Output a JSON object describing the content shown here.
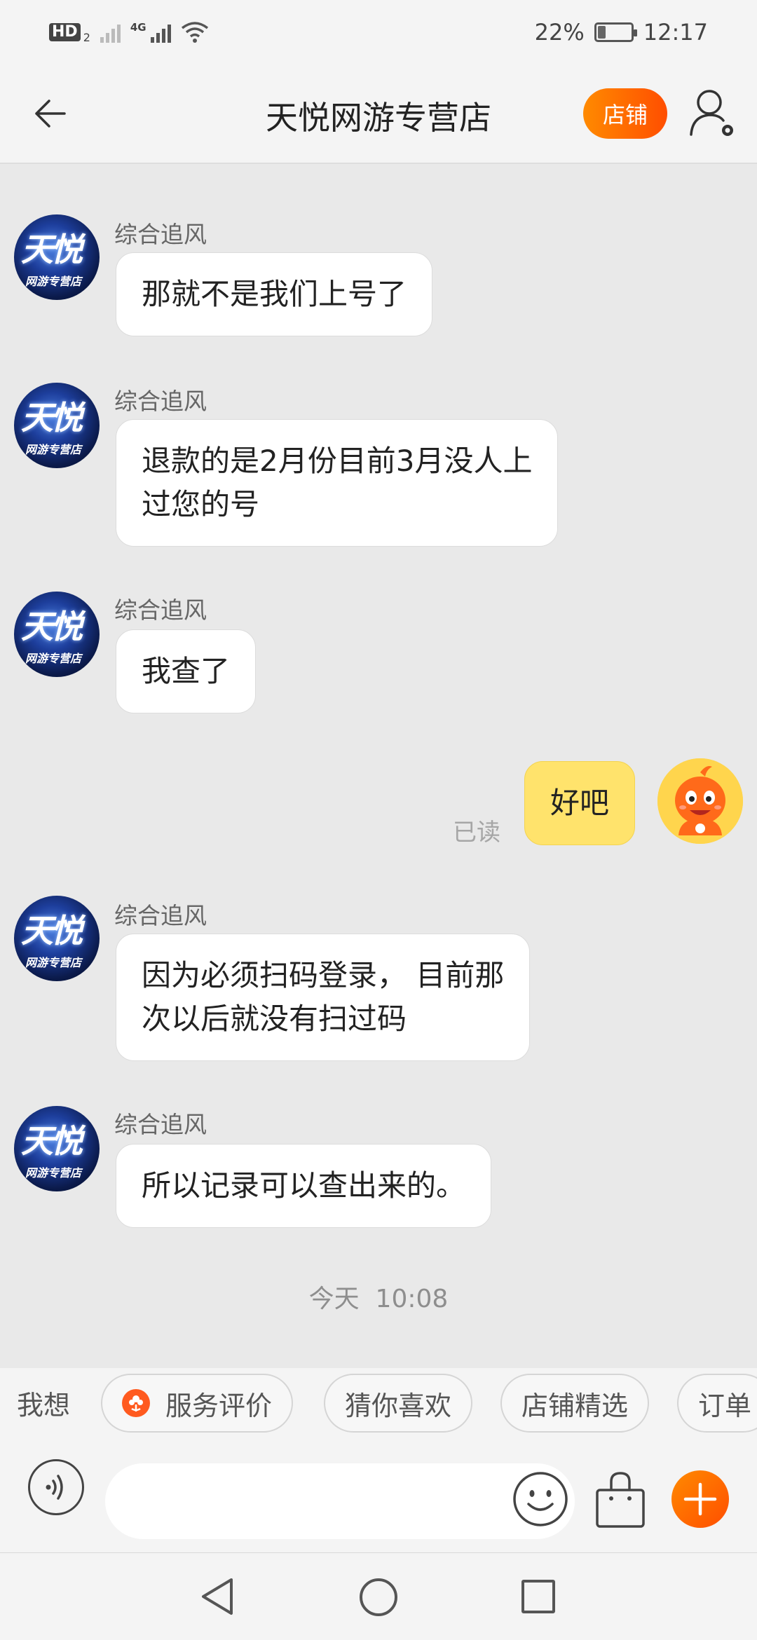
{
  "status_bar": {
    "hd": "HD",
    "hd_sub": "2",
    "network": "4G",
    "battery": "22%",
    "battery_level": 0.22,
    "time": "12:17"
  },
  "header": {
    "title": "天悦网游专营店",
    "shop_button": "店铺"
  },
  "messages": [
    {
      "sender": "综合追风",
      "text": "那就不是我们上号了"
    },
    {
      "sender": "综合追风",
      "text_lines": [
        "退款的是2月份目前3月没人上",
        "过您的号"
      ]
    },
    {
      "sender": "综合追风",
      "text": "我查了"
    },
    {
      "self": true,
      "text": "好吧",
      "read_status": "已读"
    },
    {
      "sender": "综合追风",
      "text_lines": [
        "因为必须扫码登录， 目前那",
        "次以后就没有扫过码"
      ]
    },
    {
      "sender": "综合追风",
      "text": "所以记录可以查出来的。"
    }
  ],
  "shop_avatar": {
    "title": "天悦",
    "subtitle": "网游专营店"
  },
  "time_divider": "今天  10:08",
  "quick_replies": {
    "label": "我想",
    "chips": [
      "服务评价",
      "猜你喜欢",
      "店铺精选",
      "订单"
    ]
  },
  "input": {
    "placeholder": ""
  },
  "icons": {
    "back": "back-arrow-icon",
    "user_settings": "user-settings-icon",
    "voice": "voice-icon",
    "emoji": "emoji-icon",
    "bag": "shopping-bag-icon",
    "plus": "plus-icon"
  },
  "colors": {
    "accent": "#ff6a00",
    "self_bubble": "#ffe36c",
    "chat_bg": "#e9e9e9"
  }
}
